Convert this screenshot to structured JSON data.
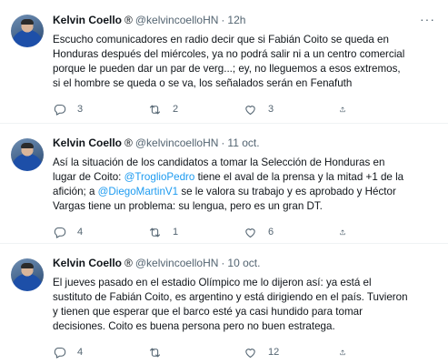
{
  "tweets": [
    {
      "name": "Kelvin Coello",
      "badge": "®",
      "handle": "@kelvincoelloHN",
      "dot": "·",
      "time": "12h",
      "text_parts": [
        {
          "text": "Escucho comunicadores en radio decir que si Fabián Coito se queda en\nHonduras después del miércoles, ya no podrá salir ni a un centro comercial\nporque le pueden dar un par de verg...; ey, no lleguemos a esos extremos,\nsi el hombre se queda o se va, los señalados serán en Fenafuth"
        }
      ],
      "replies": "3",
      "retweets": "2",
      "likes": "3"
    },
    {
      "name": "Kelvin Coello",
      "badge": "®",
      "handle": "@kelvincoelloHN",
      "dot": "·",
      "time": "11 oct.",
      "text_parts": [
        {
          "text": "Así la situación de los candidatos a tomar la Selección de Honduras en\nlugar de Coito: "
        },
        {
          "text": "@TroglioPedro",
          "mention": true
        },
        {
          "text": " tiene el aval de la prensa y la mitad +1 de la\nafición; a "
        },
        {
          "text": "@DiegoMartinV1",
          "mention": true
        },
        {
          "text": " se le valora su trabajo y es aprobado y Héctor\nVargas tiene un problema: su lengua, pero es un gran DT."
        }
      ],
      "replies": "4",
      "retweets": "1",
      "likes": "6"
    },
    {
      "name": "Kelvin Coello",
      "badge": "®",
      "handle": "@kelvincoelloHN",
      "dot": "·",
      "time": "10 oct.",
      "text_parts": [
        {
          "text": "El jueves pasado en el estadio Olímpico me lo dijeron así: ya está el\nsustituto de Fabián Coito, es argentino y está dirigiendo en el país. Tuvieron\ny tienen que esperar que el barco esté ya casi hundido para tomar\ndecisiones. Coito es buena persona pero no buen estratega."
        }
      ],
      "replies": "4",
      "retweets": "",
      "likes": "12"
    }
  ],
  "more_label": "···",
  "icons": [
    "reply-icon",
    "retweet-icon",
    "like-icon",
    "share-icon"
  ],
  "colors": {
    "text": "#0f1419",
    "secondary": "#536471",
    "mention": "#1d9bf0",
    "divider": "#eff3f4"
  }
}
